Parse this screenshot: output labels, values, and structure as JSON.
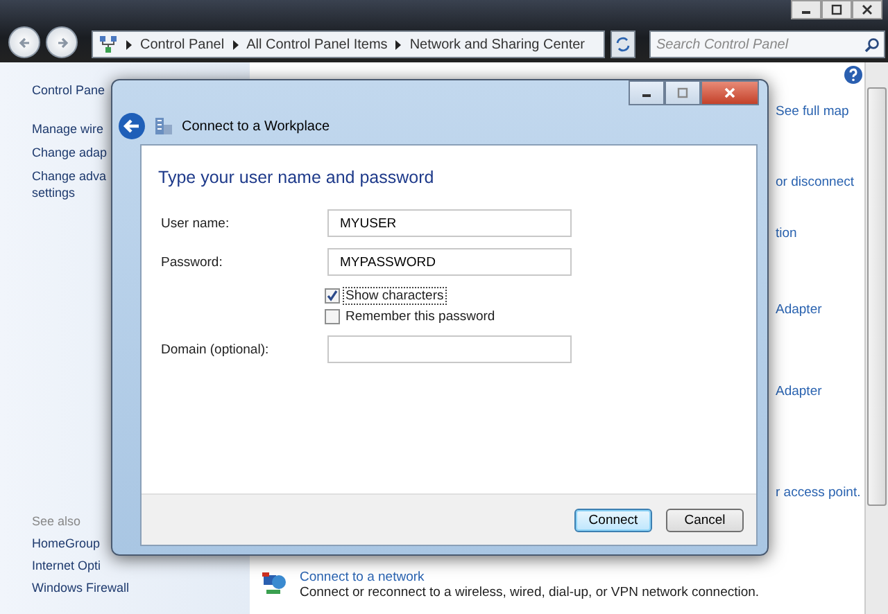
{
  "address_bar": {
    "breadcrumbs": [
      "Control Panel",
      "All Control Panel Items",
      "Network and Sharing Center"
    ]
  },
  "search": {
    "placeholder": "Search Control Panel"
  },
  "sidebar": {
    "items": [
      {
        "lines": [
          "Control Pane"
        ]
      },
      {
        "lines": [
          "Manage wire"
        ]
      },
      {
        "lines": [
          "Change adap"
        ]
      },
      {
        "lines": [
          "Change adva",
          "settings"
        ]
      }
    ],
    "see_also": {
      "heading": "See also",
      "items": [
        "HomeGroup",
        "Internet Opti",
        "Windows Firewall"
      ]
    }
  },
  "main": {
    "fragments": [
      "See full map",
      "or disconnect",
      "tion",
      "Adapter",
      "Adapter",
      "r access point."
    ],
    "task": {
      "title": "Connect to a network",
      "description": "Connect or reconnect to a wireless, wired, dial-up, or VPN network connection."
    }
  },
  "dialog": {
    "title": "Connect to a Workplace",
    "heading": "Type your user name and password",
    "fields": [
      {
        "label": "User name:",
        "value": "MYUSER"
      },
      {
        "label": "Password:",
        "value": "MYPASSWORD"
      }
    ],
    "checkboxes": [
      {
        "label": "Show characters",
        "checked": true
      },
      {
        "label": "Remember this password",
        "checked": false
      }
    ],
    "domain": {
      "label": "Domain (optional):"
    },
    "buttons": [
      {
        "label": "Connect",
        "default": true
      },
      {
        "label": "Cancel",
        "default": false
      }
    ]
  }
}
